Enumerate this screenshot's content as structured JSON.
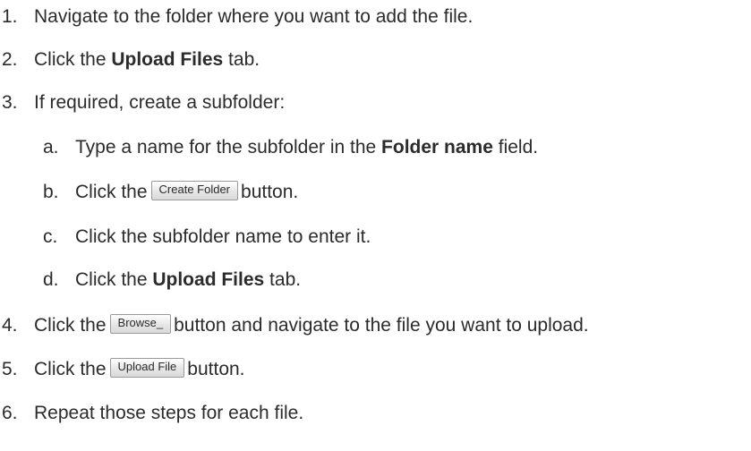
{
  "steps": [
    {
      "num": "1.",
      "text": "Navigate to the folder where you want to add the file."
    },
    {
      "num": "2.",
      "pre": "Click the ",
      "bold": "Upload Files",
      "post": " tab."
    },
    {
      "num": "3.",
      "text": "If required, create a subfolder:"
    },
    {
      "num": "4.",
      "pre": "Click the",
      "button": "Browse_",
      "post": "button and navigate to the file you want to upload."
    },
    {
      "num": "5.",
      "pre": "Click the",
      "button": "Upload File",
      "post": "button."
    },
    {
      "num": "6.",
      "text": "Repeat those steps for each file."
    }
  ],
  "substeps": [
    {
      "num": "a.",
      "pre": "Type a name for the subfolder in the ",
      "bold": "Folder name",
      "post": " field."
    },
    {
      "num": "b.",
      "pre": "Click the",
      "button": "Create Folder",
      "post": "button."
    },
    {
      "num": "c.",
      "text": "Click the subfolder name to enter it."
    },
    {
      "num": "d.",
      "pre": "Click the ",
      "bold": "Upload Files",
      "post": " tab."
    }
  ]
}
